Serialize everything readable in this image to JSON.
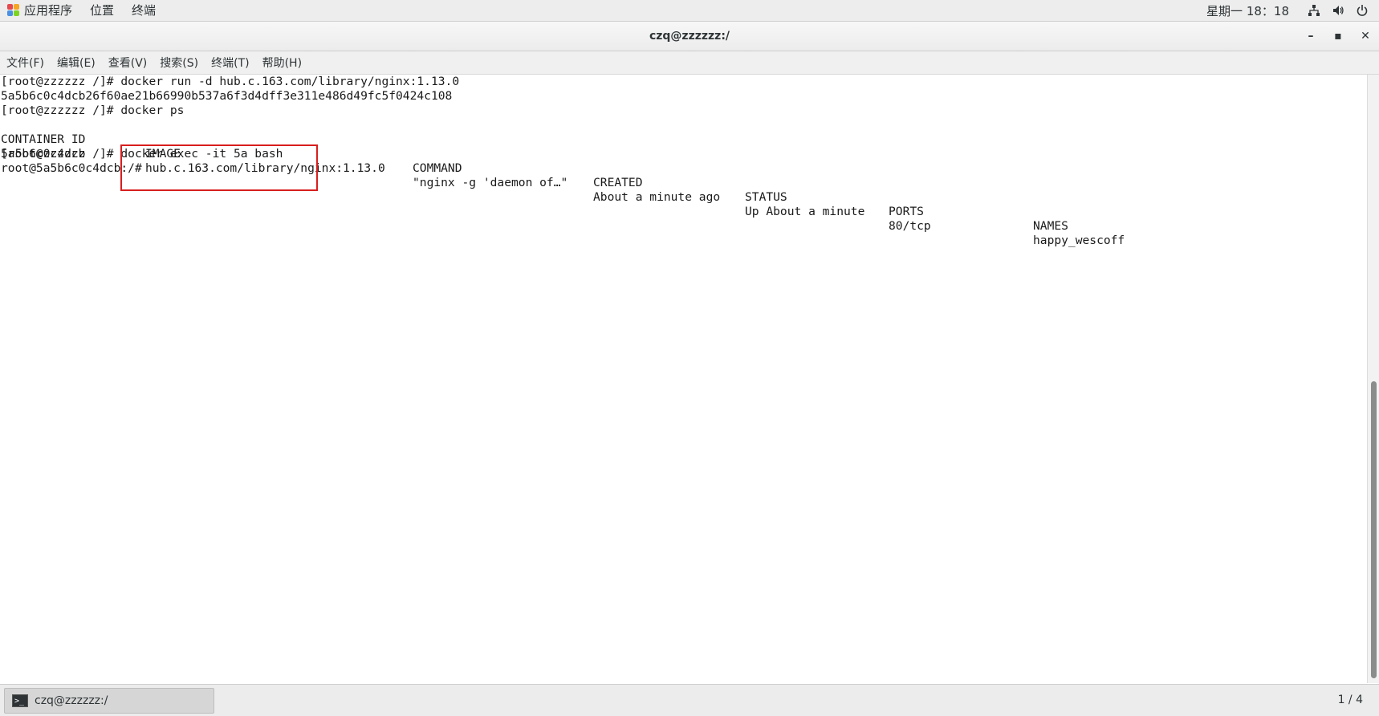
{
  "top_panel": {
    "menus": [
      "应用程序",
      "位置",
      "终端"
    ],
    "clock": "星期一 18：18",
    "icons": [
      "network-icon",
      "volume-icon",
      "power-icon"
    ]
  },
  "window": {
    "title": "czq@zzzzzz:/",
    "controls": {
      "minimize": "–",
      "maximize": "▪",
      "close": "✕"
    }
  },
  "menubar": {
    "items": [
      "文件(F)",
      "编辑(E)",
      "查看(V)",
      "搜索(S)",
      "终端(T)",
      "帮助(H)"
    ]
  },
  "terminal": {
    "lines": [
      "[root@zzzzzz /]# docker run -d hub.c.163.com/library/nginx:1.13.0",
      "5a5b6c0c4dcb26f60ae21b66990b537a6f3d4dff3e311e486d49fc5f0424c108",
      "[root@zzzzzz /]# docker ps"
    ],
    "ps_header": {
      "container_id": "CONTAINER ID",
      "image": "IMAGE",
      "command": "COMMAND",
      "created": "CREATED",
      "status": "STATUS",
      "ports": "PORTS",
      "names": "NAMES"
    },
    "ps_row": {
      "container_id": "5a5b6c0c4dcb",
      "image": "hub.c.163.com/library/nginx:1.13.0",
      "command": "\"nginx -g 'daemon of…\"",
      "created": "About a minute ago",
      "status": "Up About a minute",
      "ports": "80/tcp",
      "names": "happy_wescoff"
    },
    "exec_prompt": "[root@zzzzzz /]# ",
    "exec_command": "docker exec -it 5a bash",
    "container_prompt_user": "root@5a5b6c0c4dcb",
    "container_prompt_path": ":/#"
  },
  "bottom_panel": {
    "task_label": "czq@zzzzzz:/",
    "workspace": "1 / 4"
  },
  "colors": {
    "highlight_box": "#d81e1e",
    "panel_bg": "#ededed"
  }
}
